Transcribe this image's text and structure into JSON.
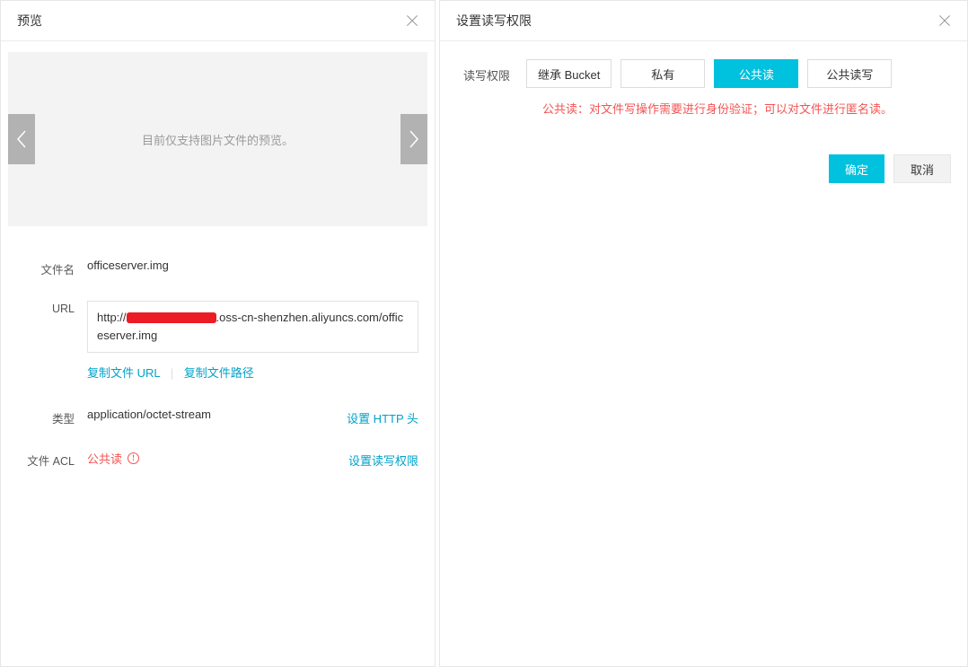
{
  "left": {
    "title": "预览",
    "preview_placeholder": "目前仅支持图片文件的预览。",
    "fields": {
      "filename_label": "文件名",
      "filename_value": "officeserver.img",
      "url_label": "URL",
      "url_prefix": "http://",
      "url_suffix": ".oss-cn-shenzhen.aliyuncs.com/officeserver.img",
      "copy_url_label": "复制文件 URL",
      "copy_path_label": "复制文件路径",
      "type_label": "类型",
      "type_value": "application/octet-stream",
      "set_http_header_label": "设置 HTTP 头",
      "acl_label": "文件 ACL",
      "acl_value": "公共读",
      "set_acl_label": "设置读写权限"
    }
  },
  "right": {
    "title": "设置读写权限",
    "form": {
      "acl_label": "读写权限",
      "options": {
        "inherit": "继承 Bucket",
        "private": "私有",
        "public_read": "公共读",
        "public_rw": "公共读写"
      },
      "active_option": "public_read",
      "hint": "公共读：对文件写操作需要进行身份验证；可以对文件进行匿名读。"
    },
    "actions": {
      "confirm": "确定",
      "cancel": "取消"
    }
  }
}
